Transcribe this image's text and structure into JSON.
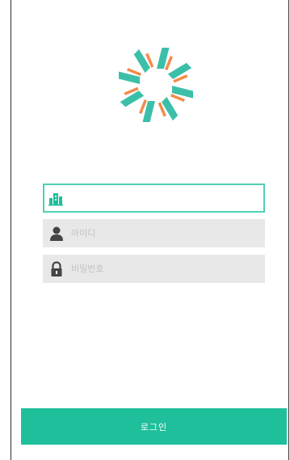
{
  "login": {
    "company_icon": "building-icon",
    "company_value": "",
    "id_icon": "user-icon",
    "id_placeholder": "아이디",
    "password_icon": "lock-icon",
    "password_placeholder": "비밀번호",
    "button_label": "로그인"
  },
  "colors": {
    "accent": "#1fbf9c",
    "accent_border": "#4fd0b3",
    "logo_teal": "#3cbfa8",
    "logo_orange": "#f28b4a",
    "field_bg": "#e8e8e8",
    "icon_gray": "#444444"
  }
}
